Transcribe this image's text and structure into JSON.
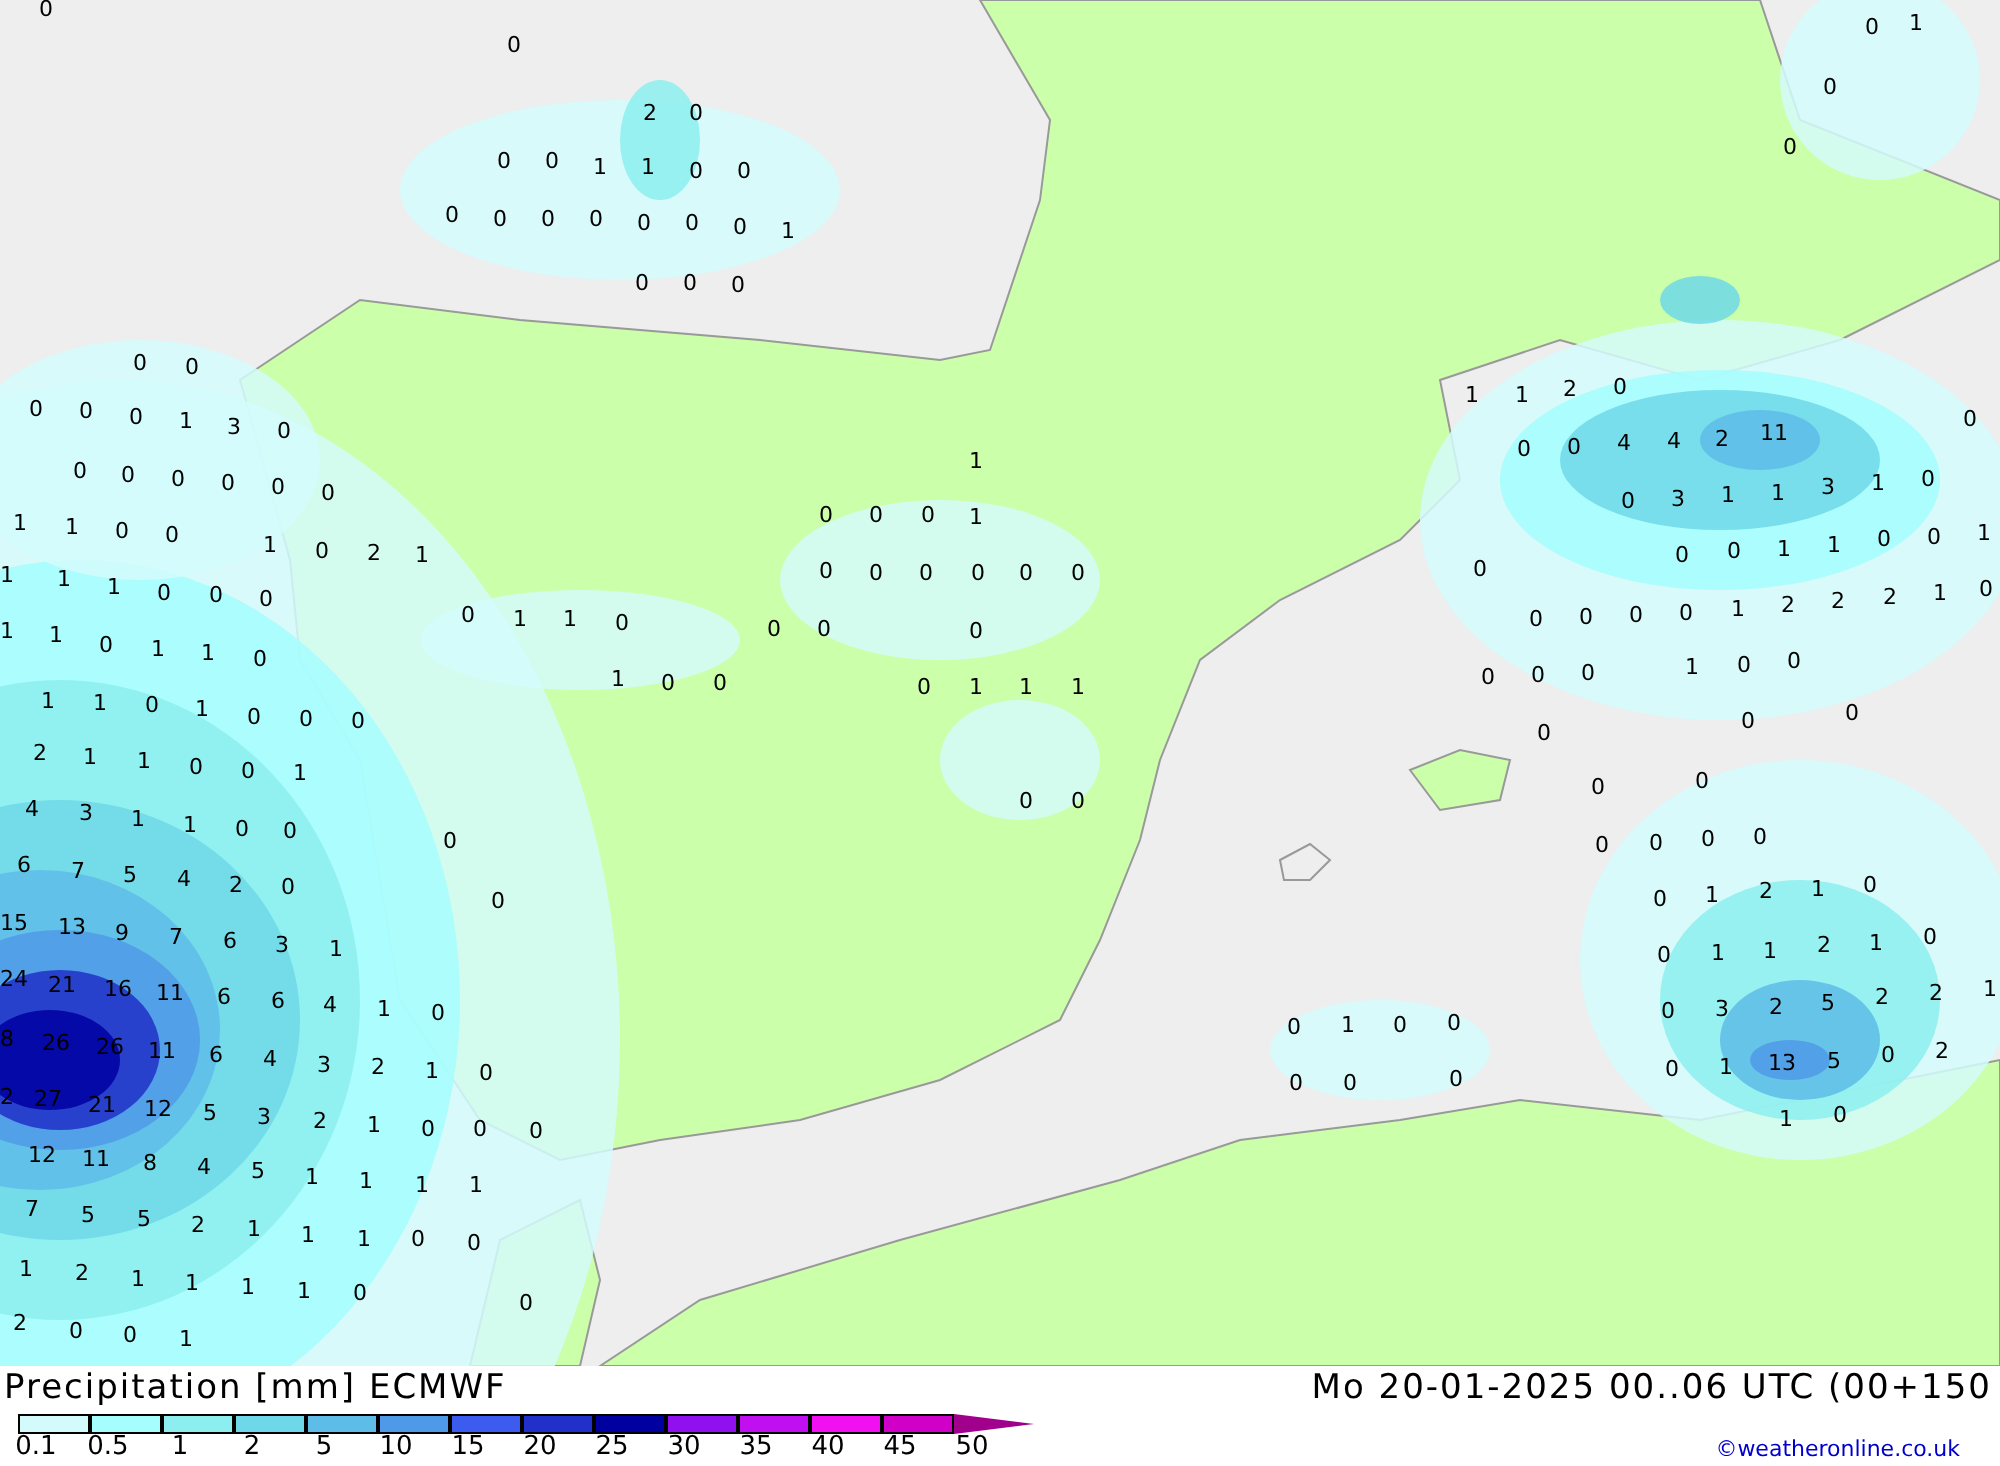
{
  "map": {
    "values": [
      "0",
      "0",
      "1",
      "0",
      "0",
      "2",
      "0",
      "0",
      "0",
      "0",
      "1",
      "1",
      "0",
      "0",
      "0",
      "0",
      "0",
      "0",
      "0",
      "0",
      "0",
      "1",
      "0",
      "0",
      "0",
      "0",
      "0",
      "1",
      "1",
      "2",
      "0",
      "0",
      "0",
      "0",
      "1",
      "3",
      "0",
      "0",
      "0",
      "4",
      "4",
      "2",
      "11",
      "0",
      "0",
      "0",
      "0",
      "0",
      "0",
      "0",
      "1",
      "0",
      "3",
      "1",
      "1",
      "3",
      "1",
      "0",
      "1",
      "1",
      "0",
      "0",
      "1",
      "0",
      "2",
      "1",
      "0",
      "0",
      "0",
      "1",
      "0",
      "0",
      "1",
      "1",
      "0",
      "0",
      "1",
      "1",
      "1",
      "1",
      "0",
      "0",
      "0",
      "0",
      "0",
      "0",
      "0",
      "0",
      "0",
      "0",
      "1",
      "1",
      "0",
      "1",
      "1",
      "0",
      "0",
      "0",
      "0",
      "0",
      "0",
      "0",
      "0",
      "1",
      "2",
      "2",
      "2",
      "1",
      "0",
      "0",
      "1",
      "1",
      "0",
      "1",
      "0",
      "0",
      "0",
      "1",
      "1",
      "1",
      "0",
      "0",
      "0",
      "1",
      "0",
      "0",
      "1",
      "1",
      "0",
      "1",
      "0",
      "0",
      "0",
      "0",
      "0",
      "0",
      "2",
      "1",
      "1",
      "0",
      "0",
      "1",
      "0",
      "0",
      "4",
      "3",
      "1",
      "1",
      "0",
      "0",
      "0",
      "0",
      "0",
      "0",
      "0",
      "0",
      "0",
      "6",
      "7",
      "5",
      "4",
      "2",
      "0",
      "0",
      "0",
      "1",
      "2",
      "1",
      "0",
      "15",
      "13",
      "9",
      "7",
      "6",
      "3",
      "1",
      "0",
      "1",
      "1",
      "2",
      "1",
      "0",
      "24",
      "21",
      "16",
      "11",
      "6",
      "6",
      "4",
      "1",
      "0",
      "0",
      "3",
      "2",
      "5",
      "2",
      "2",
      "1",
      "0",
      "1",
      "0",
      "0",
      "8",
      "26",
      "26",
      "11",
      "6",
      "4",
      "3",
      "2",
      "1",
      "0",
      "0",
      "0",
      "0",
      "0",
      "1",
      "13",
      "5",
      "0",
      "2",
      "2",
      "27",
      "21",
      "12",
      "5",
      "3",
      "2",
      "1",
      "0",
      "0",
      "0",
      "1",
      "0",
      "12",
      "11",
      "8",
      "4",
      "5",
      "1",
      "1",
      "1",
      "1",
      "7",
      "5",
      "5",
      "2",
      "1",
      "1",
      "1",
      "0",
      "0",
      "1",
      "2",
      "1",
      "1",
      "1",
      "1",
      "0",
      "0",
      "2",
      "0",
      "0",
      "1"
    ]
  },
  "legend": {
    "title": "Precipitation [mm] ECMWF",
    "valid_time": "Mo 20-01-2025 00..06 UTC (00+150",
    "scale": [
      {
        "label": "0.1",
        "color": "#d4fbfb"
      },
      {
        "label": "0.5",
        "color": "#a5fdfd"
      },
      {
        "label": "1",
        "color": "#8ceeee"
      },
      {
        "label": "2",
        "color": "#6ed8e8"
      },
      {
        "label": "5",
        "color": "#5ebce8"
      },
      {
        "label": "10",
        "color": "#4f9ae8"
      },
      {
        "label": "15",
        "color": "#3c5cf0"
      },
      {
        "label": "20",
        "color": "#2030c8"
      },
      {
        "label": "25",
        "color": "#0000a0"
      },
      {
        "label": "30",
        "color": "#9010f0"
      },
      {
        "label": "35",
        "color": "#c010f0"
      },
      {
        "label": "40",
        "color": "#f010f0"
      },
      {
        "label": "45",
        "color": "#d000c8"
      },
      {
        "label": "50",
        "color": "#a0008c"
      }
    ]
  },
  "credit": "©weatheronline.co.uk"
}
